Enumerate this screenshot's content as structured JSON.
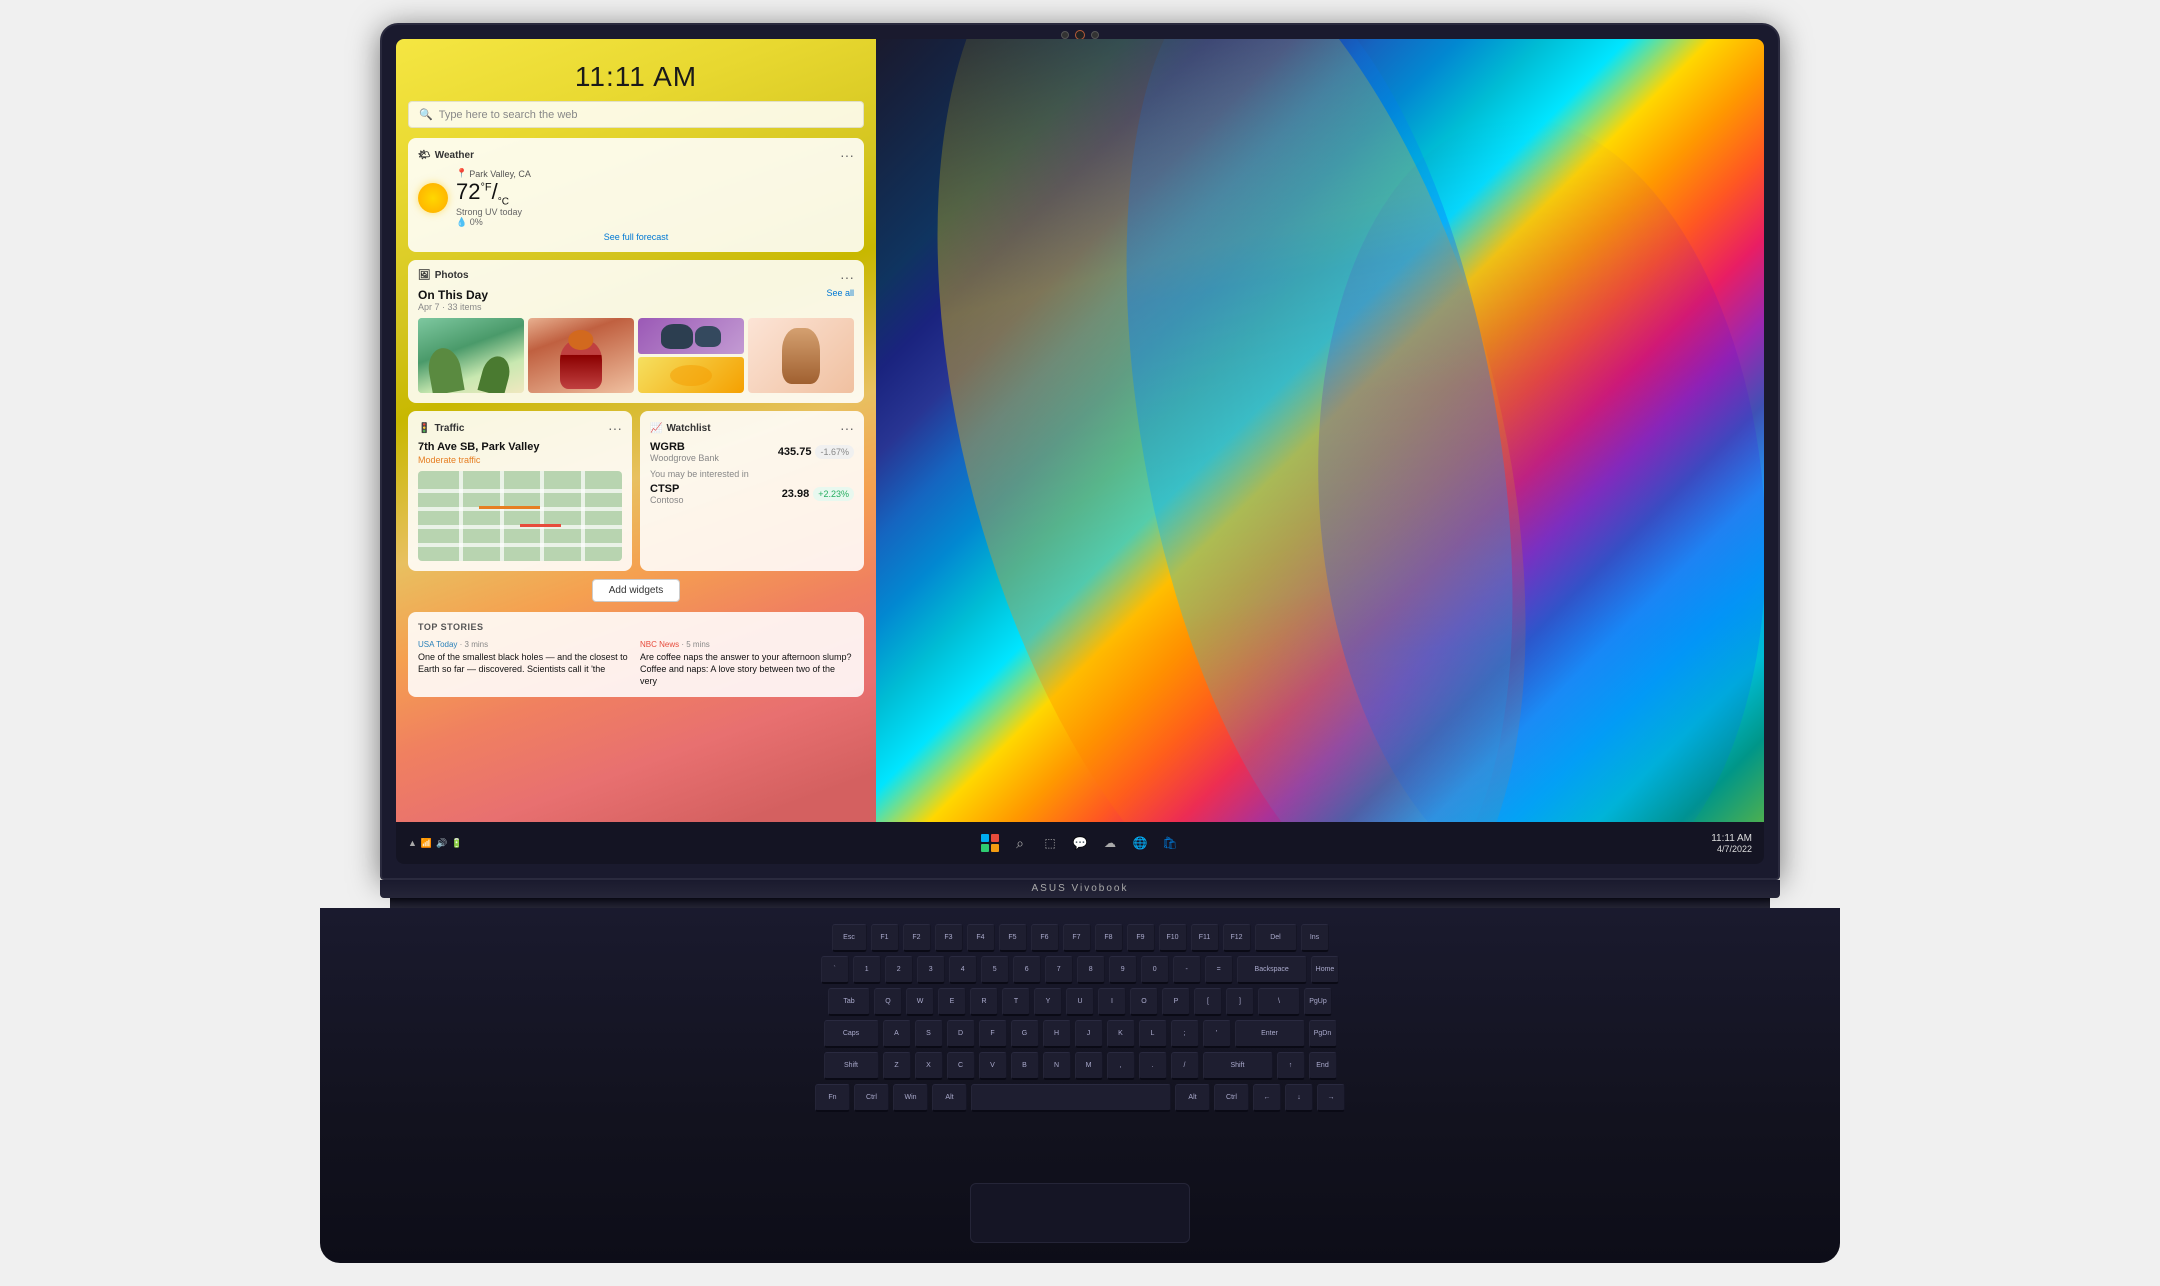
{
  "laptop": {
    "brand": "ASUS Vivobook"
  },
  "screen": {
    "clock": "11:11 AM",
    "search": {
      "placeholder": "Type here to search the web"
    },
    "widgets": {
      "weather": {
        "title": "Weather",
        "location": "Park Valley, CA",
        "temperature": "72",
        "unit": "°F",
        "unit2": "°C",
        "description": "Strong UV today",
        "precipitation": "0%",
        "forecast_link": "See full forecast",
        "more_icon": "···"
      },
      "photos": {
        "title": "Photos",
        "on_this_day": "On This Day",
        "date": "Apr 7 · 33 items",
        "see_all": "See all",
        "more_icon": "···"
      },
      "traffic": {
        "title": "Traffic",
        "address": "7th Ave SB, Park Valley",
        "status": "Moderate traffic",
        "more_icon": "···"
      },
      "watchlist": {
        "title": "Watchlist",
        "more_icon": "···",
        "stock1": {
          "ticker": "WGRB",
          "name": "Woodgrove Bank",
          "price": "435.75",
          "change": "-1.67%"
        },
        "interested_label": "You may be interested in",
        "stock2": {
          "ticker": "CTSP",
          "name": "Contoso",
          "price": "23.98",
          "change": "+2.23%"
        }
      }
    },
    "add_widgets_btn": "Add widgets",
    "top_stories": {
      "label": "TOP STORIES",
      "stories": [
        {
          "source": "USA Today · 3 mins",
          "headline": "One of the smallest black holes — and the closest to Earth so far — discovered. Scientists call it 'the"
        },
        {
          "source": "NBC News · 5 mins",
          "headline": "Are coffee naps the answer to your afternoon slump? Coffee and naps: A love story between two of the very"
        }
      ]
    },
    "taskbar": {
      "icons": [
        "⊞",
        "🔍",
        "⬜",
        "💬",
        "☁",
        "🌐"
      ],
      "time": "11:11 AM",
      "date": "4/7/2022"
    }
  },
  "keyboard": {
    "rows": [
      [
        "Esc",
        "F1",
        "F2",
        "F3",
        "F4",
        "F5",
        "F6",
        "F7",
        "F8",
        "F9",
        "F10",
        "F11",
        "F12",
        "Del"
      ],
      [
        "`",
        "1",
        "2",
        "3",
        "4",
        "5",
        "6",
        "7",
        "8",
        "9",
        "0",
        "-",
        "=",
        "Backspace"
      ],
      [
        "Tab",
        "Q",
        "W",
        "E",
        "R",
        "T",
        "Y",
        "U",
        "I",
        "O",
        "P",
        "[",
        "]",
        "\\"
      ],
      [
        "Caps",
        "A",
        "S",
        "D",
        "F",
        "G",
        "H",
        "J",
        "K",
        "L",
        ";",
        "'",
        "Enter"
      ],
      [
        "Shift",
        "Z",
        "X",
        "C",
        "V",
        "B",
        "N",
        "M",
        ",",
        ".",
        "/",
        "Shift"
      ],
      [
        "Fn",
        "Ctrl",
        "Win",
        "Alt",
        "Space",
        "Alt",
        "Ctrl",
        "←",
        "↑↓",
        "→"
      ]
    ]
  }
}
